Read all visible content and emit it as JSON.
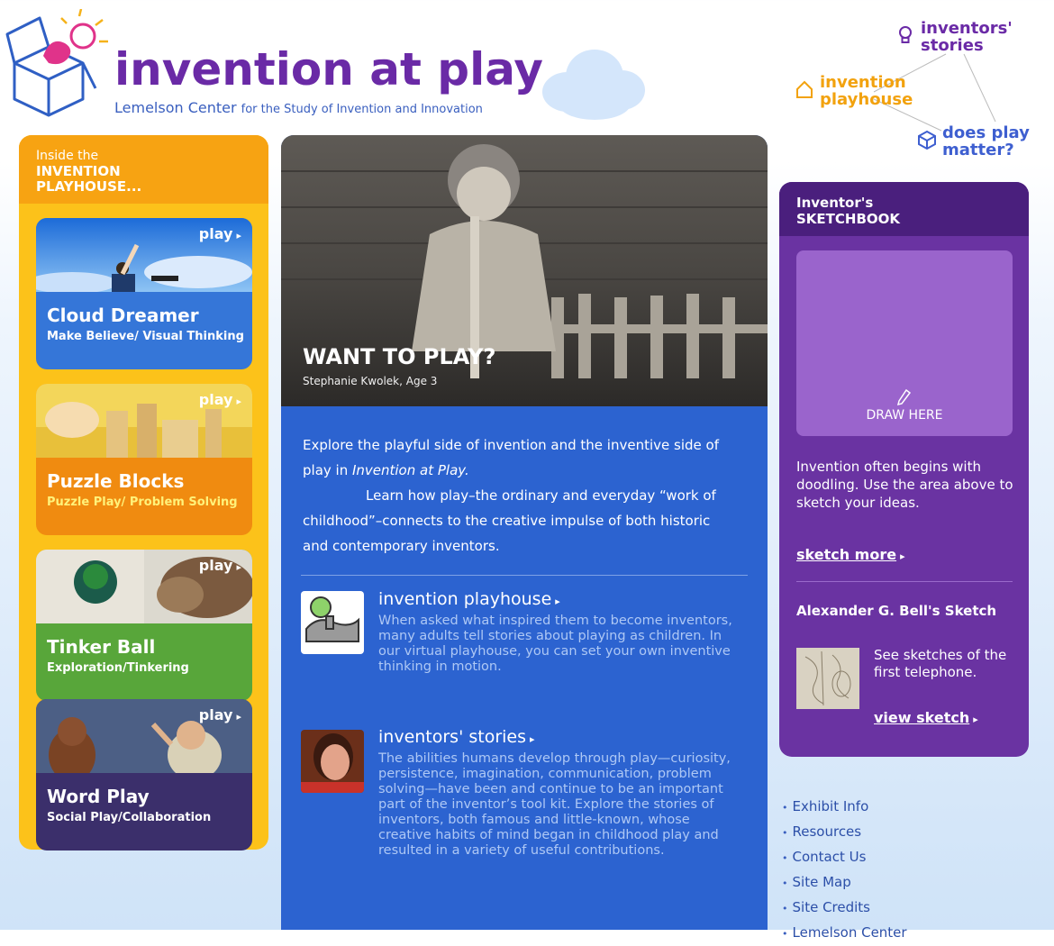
{
  "header": {
    "site_title": "invention at play",
    "subtitle_main": "Lemelson Center",
    "subtitle_rest": "for the Study of Invention and Innovation",
    "nav": {
      "stories": [
        "inventors'",
        "stories"
      ],
      "playhouse": [
        "invention",
        "playhouse"
      ],
      "matter": [
        "does play",
        "matter?"
      ]
    }
  },
  "left": {
    "heading_top": "Inside the",
    "heading_line1": "INVENTION",
    "heading_line2": "PLAYHOUSE...",
    "games": [
      {
        "play": "play",
        "title": "Cloud Dreamer",
        "sub": "Make Believe/ Visual Thinking",
        "bg": "#3576d8",
        "sub_color": "#ffffff"
      },
      {
        "play": "play",
        "title": "Puzzle Blocks",
        "sub": "Puzzle Play/ Problem Solving",
        "bg": "#f08b10",
        "sub_color": "#fff27a"
      },
      {
        "play": "play",
        "title": "Tinker Ball",
        "sub": "Exploration/Tinkering",
        "bg": "#58a63a",
        "sub_color": "#ffffff"
      },
      {
        "play": "play",
        "title": "Word Play",
        "sub": "Social Play/Collaboration",
        "bg": "#3b2f6b",
        "sub_color": "#ffffff"
      }
    ]
  },
  "center": {
    "hero_title": "WANT TO PLAY?",
    "hero_caption": "Stephanie Kwolek, Age 3",
    "intro_p1": "Explore the playful side of invention and the inventive side of play in ",
    "intro_p1_em": "Invention at Play.",
    "intro_p2": "Learn how play–the ordinary and everyday “work of childhood”–connects to the creative impulse of both historic and contemporary inventors.",
    "features": [
      {
        "title": "invention playhouse",
        "body": "When asked what inspired them to become inventors, many adults tell stories about playing as children. In our virtual playhouse, you can set your own inventive thinking in motion."
      },
      {
        "title": "inventors' stories",
        "body": "The abilities humans develop through play—curiosity, persistence, imagination, communication, problem solving—have been and continue to be an important part of the inventor’s tool kit. Explore the stories of inventors, both famous and little-known, whose creative habits of mind began in childhood play and resulted in a variety of useful contributions."
      }
    ]
  },
  "right": {
    "heading_top": "Inventor's",
    "heading": "SKETCHBOOK",
    "draw_label": "DRAW HERE",
    "description": "Invention often begins with doodling. Use the area above to sketch your ideas.",
    "sketch_more": "sketch more",
    "bell_title": "Alexander G. Bell's Sketch",
    "bell_desc": "See sketches of the first telephone.",
    "view_sketch": "view sketch"
  },
  "footer_links": [
    "Exhibit Info",
    "Resources",
    "Contact Us",
    "Site Map",
    "Site Credits",
    "Lemelson Center"
  ],
  "colors": {
    "purple": "#6a2aa6",
    "orange": "#f7a312",
    "yellow": "#fcc21a",
    "blue": "#2c63d0",
    "sketch_purple": "#6a33a2"
  },
  "icons": [
    "lightbulb-icon",
    "house-icon",
    "cube-icon",
    "pencil-icon",
    "arrow-right-icon"
  ]
}
